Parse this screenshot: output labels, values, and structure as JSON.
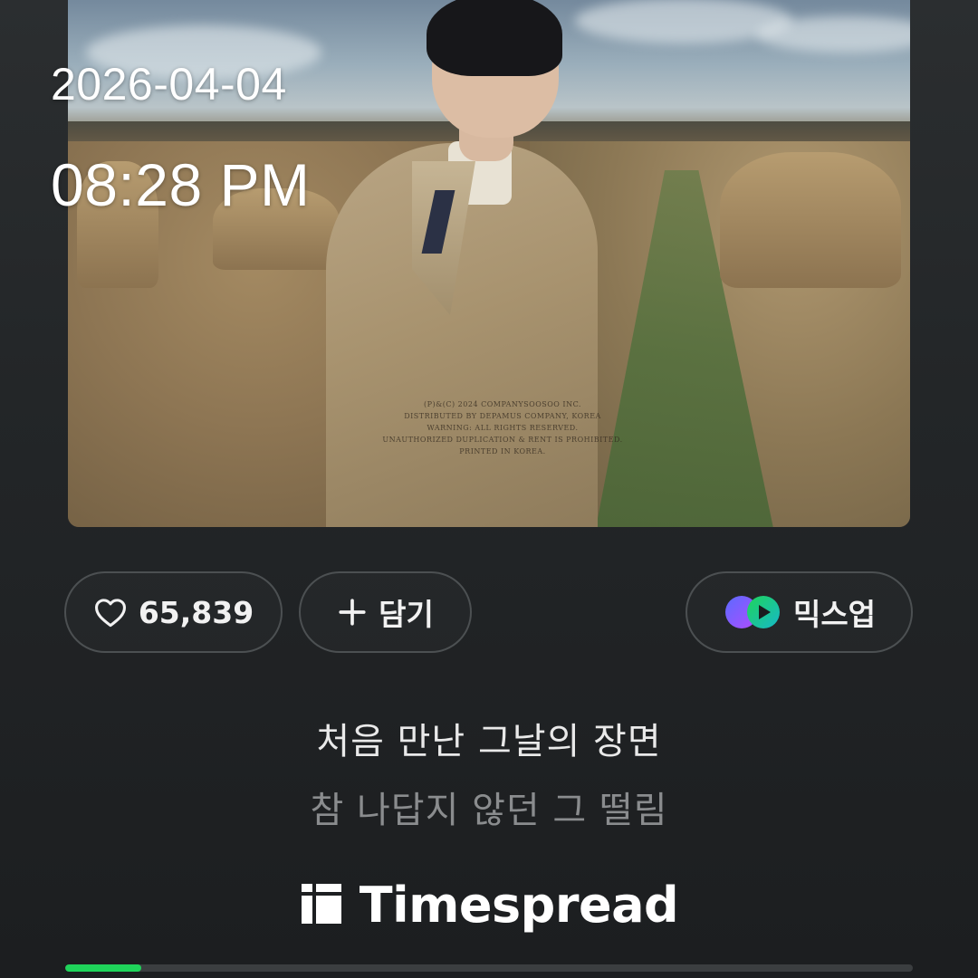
{
  "overlay": {
    "date": "2026-04-04",
    "time": "08:28 PM"
  },
  "album": {
    "copyright_lines": [
      "(P)&(C) 2024 COMPANYSOOSOO INC.",
      "DISTRIBUTED BY DEPAMUS COMPANY, KOREA",
      "WARNING: ALL RIGHTS RESERVED.",
      "UNAUTHORIZED DUPLICATION & RENT IS PROHIBITED.",
      "PRINTED IN KOREA."
    ]
  },
  "actions": {
    "like_count": "65,839",
    "add_label": "담기",
    "mixup_label": "믹스업"
  },
  "lyrics": {
    "current": "처음 만난 그날의 장면",
    "next": "참 나답지 않던 그 떨림"
  },
  "brand": {
    "name": "Timespread"
  },
  "progress": {
    "fraction": 0.09
  },
  "colors": {
    "accent_green": "#1fd45a",
    "background": "#232628",
    "pill_border": "#4c5052"
  }
}
